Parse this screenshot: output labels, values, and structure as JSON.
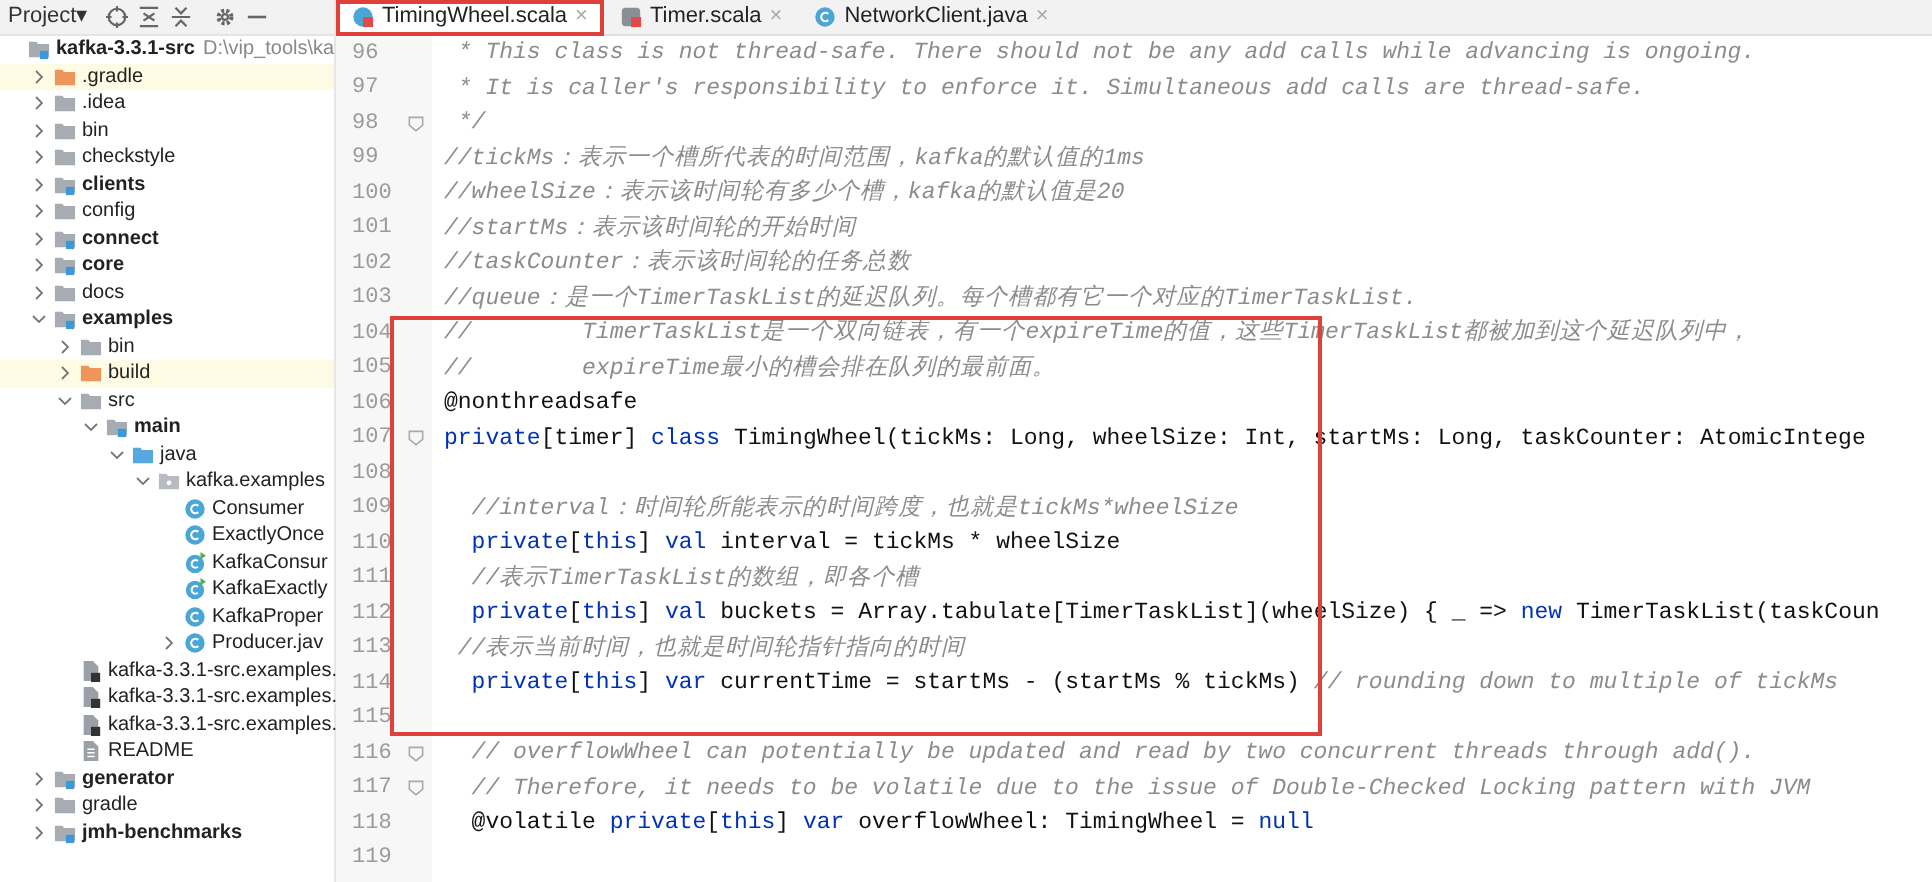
{
  "project_panel": {
    "title": "Project▾",
    "tree": [
      {
        "label": "kafka-3.3.1-src",
        "path": "D:\\vip_tools\\ka",
        "kind": "module",
        "children": [
          {
            "label": ".gradle",
            "kind": "excluded",
            "expanded": false
          },
          {
            "label": ".idea",
            "kind": "folder",
            "expanded": false
          },
          {
            "label": "bin",
            "kind": "folder",
            "expanded": false
          },
          {
            "label": "checkstyle",
            "kind": "folder",
            "expanded": false
          },
          {
            "label": "clients",
            "kind": "module",
            "expanded": false
          },
          {
            "label": "config",
            "kind": "folder",
            "expanded": false
          },
          {
            "label": "connect",
            "kind": "module",
            "expanded": false
          },
          {
            "label": "core",
            "kind": "module",
            "expanded": false
          },
          {
            "label": "docs",
            "kind": "folder",
            "expanded": false
          },
          {
            "label": "examples",
            "kind": "module",
            "expanded": true,
            "children": [
              {
                "label": "bin",
                "kind": "folder",
                "expanded": false
              },
              {
                "label": "build",
                "kind": "excluded",
                "expanded": false
              },
              {
                "label": "src",
                "kind": "folder",
                "expanded": true,
                "children": [
                  {
                    "label": "main",
                    "kind": "module",
                    "expanded": true,
                    "children": [
                      {
                        "label": "java",
                        "kind": "source",
                        "expanded": true,
                        "children": [
                          {
                            "label": "kafka.examples",
                            "kind": "package",
                            "expanded": true,
                            "children": [
                              {
                                "label": "Consumer",
                                "kind": "class"
                              },
                              {
                                "label": "ExactlyOnce",
                                "kind": "class"
                              },
                              {
                                "label": "KafkaConsur",
                                "kind": "runnable"
                              },
                              {
                                "label": "KafkaExactly",
                                "kind": "runnable"
                              },
                              {
                                "label": "KafkaProper",
                                "kind": "class"
                              },
                              {
                                "label": "Producer.jav",
                                "kind": "class",
                                "expanded": false
                              }
                            ]
                          }
                        ]
                      }
                    ]
                  }
                ]
              },
              {
                "label": "kafka-3.3.1-src.examples.",
                "kind": "iml"
              },
              {
                "label": "kafka-3.3.1-src.examples.",
                "kind": "iml"
              },
              {
                "label": "kafka-3.3.1-src.examples.",
                "kind": "iml"
              },
              {
                "label": "README",
                "kind": "text"
              }
            ]
          },
          {
            "label": "generator",
            "kind": "module",
            "expanded": false
          },
          {
            "label": "gradle",
            "kind": "folder",
            "expanded": false
          },
          {
            "label": "jmh-benchmarks",
            "kind": "module",
            "expanded": false
          }
        ]
      }
    ]
  },
  "tabs": [
    {
      "label": "TimingWheel.scala",
      "kind": "scala-class",
      "selected": true,
      "highlighted": true
    },
    {
      "label": "Timer.scala",
      "kind": "scala-trait",
      "selected": false,
      "highlighted": false
    },
    {
      "label": "NetworkClient.java",
      "kind": "java-class",
      "selected": false,
      "highlighted": false
    }
  ],
  "close_glyph": "×",
  "code_blocks": [
    {
      "highlighted": false,
      "lines": [
        {
          "no": "96",
          "segments": [
            {
              "kind": "comment",
              "text": " * This class is not thread-safe. There should not be any add calls while advancing is ongoing."
            }
          ]
        },
        {
          "no": "97",
          "segments": [
            {
              "kind": "comment",
              "text": " * It is caller's responsibility to enforce it. Simultaneous add calls are thread-safe."
            }
          ]
        },
        {
          "no": "98",
          "fold": true,
          "segments": [
            {
              "kind": "comment",
              "text": " */"
            }
          ]
        },
        {
          "no": "99",
          "segments": [
            {
              "kind": "comment",
              "text": "//tickMs：表示一个槽所代表的时间范围，kafka的默认值的1ms"
            }
          ]
        },
        {
          "no": "100",
          "segments": [
            {
              "kind": "comment",
              "text": "//wheelSize：表示该时间轮有多少个槽，kafka的默认值是20"
            }
          ]
        },
        {
          "no": "101",
          "segments": [
            {
              "kind": "comment",
              "text": "//startMs：表示该时间轮的开始时间"
            }
          ]
        },
        {
          "no": "102",
          "segments": [
            {
              "kind": "comment",
              "text": "//taskCounter：表示该时间轮的任务总数"
            }
          ]
        },
        {
          "no": "103",
          "segments": [
            {
              "kind": "comment",
              "text": "//queue：是一个TimerTaskList的延迟队列。每个槽都有它一个对应的TimerTaskList."
            }
          ]
        }
      ]
    },
    {
      "highlighted": true,
      "lines": [
        {
          "no": "104",
          "segments": [
            {
              "kind": "comment",
              "text": "//        TimerTaskList是一个双向链表，有一个expireTime的值，这些TimerTaskList都被加到这个延迟队列中，"
            }
          ]
        },
        {
          "no": "105",
          "segments": [
            {
              "kind": "comment",
              "text": "//        expireTime最小的槽会排在队列的最前面。"
            }
          ]
        },
        {
          "no": "106",
          "segments": [
            {
              "kind": "plain",
              "text": "@nonthreadsafe"
            }
          ]
        },
        {
          "no": "107",
          "fold": true,
          "segments": [
            {
              "kind": "keyword",
              "text": "private"
            },
            {
              "kind": "plain",
              "text": "[timer] "
            },
            {
              "kind": "keyword",
              "text": "class"
            },
            {
              "kind": "plain",
              "text": " TimingWheel(tickMs: Long, wheelSize: Int, startMs: Long, taskCounter: AtomicIntege"
            }
          ]
        },
        {
          "no": "108"
        },
        {
          "no": "109",
          "segments": [
            {
              "kind": "comment",
              "text": "  //interval：时间轮所能表示的时间跨度，也就是tickMs*wheelSize"
            }
          ]
        },
        {
          "no": "110",
          "segments": [
            {
              "kind": "keyword",
              "text": "  private"
            },
            {
              "kind": "plain",
              "text": "["
            },
            {
              "kind": "keyword",
              "text": "this"
            },
            {
              "kind": "plain",
              "text": "] "
            },
            {
              "kind": "keyword",
              "text": "val"
            },
            {
              "kind": "plain",
              "text": " interval = tickMs * wheelSize"
            }
          ]
        },
        {
          "no": "111",
          "segments": [
            {
              "kind": "comment",
              "text": "  //表示TimerTaskList的数组，即各个槽"
            }
          ]
        },
        {
          "no": "112",
          "segments": [
            {
              "kind": "keyword",
              "text": "  private"
            },
            {
              "kind": "plain",
              "text": "["
            },
            {
              "kind": "keyword",
              "text": "this"
            },
            {
              "kind": "plain",
              "text": "] "
            },
            {
              "kind": "keyword",
              "text": "val"
            },
            {
              "kind": "plain",
              "text": " buckets = Array.tabulate[TimerTaskList](wheelSize) { _ => "
            },
            {
              "kind": "keyword",
              "text": "new"
            },
            {
              "kind": "plain",
              "text": " TimerTaskList(taskCoun"
            }
          ]
        },
        {
          "no": "113",
          "segments": [
            {
              "kind": "comment",
              "text": " //表示当前时间，也就是时间轮指针指向的时间"
            }
          ]
        },
        {
          "no": "114",
          "segments": [
            {
              "kind": "keyword",
              "text": "  private"
            },
            {
              "kind": "plain",
              "text": "["
            },
            {
              "kind": "keyword",
              "text": "this"
            },
            {
              "kind": "plain",
              "text": "] "
            },
            {
              "kind": "keyword",
              "text": "var"
            },
            {
              "kind": "plain",
              "text": " currentTime = startMs - (startMs % tickMs) "
            },
            {
              "kind": "comment",
              "text": "// rounding down to multiple of tickMs"
            }
          ]
        },
        {
          "no": "115"
        }
      ]
    },
    {
      "highlighted": false,
      "lines": [
        {
          "no": "116",
          "fold": true,
          "segments": [
            {
              "kind": "comment",
              "text": "  // overflowWheel can potentially be updated and read by two concurrent threads through add()."
            }
          ]
        },
        {
          "no": "117",
          "fold": true,
          "segments": [
            {
              "kind": "comment",
              "text": "  // Therefore, it needs to be volatile due to the issue of Double-Checked Locking pattern with JVM"
            }
          ]
        },
        {
          "no": "118",
          "segments": [
            {
              "kind": "plain",
              "text": "  @volatile "
            },
            {
              "kind": "keyword",
              "text": "private"
            },
            {
              "kind": "plain",
              "text": "["
            },
            {
              "kind": "keyword",
              "text": "this"
            },
            {
              "kind": "plain",
              "text": "] "
            },
            {
              "kind": "keyword",
              "text": "var"
            },
            {
              "kind": "plain",
              "text": " overflowWheel: TimingWheel = "
            },
            {
              "kind": "keyword",
              "text": "null"
            }
          ]
        },
        {
          "no": "119"
        }
      ]
    }
  ]
}
